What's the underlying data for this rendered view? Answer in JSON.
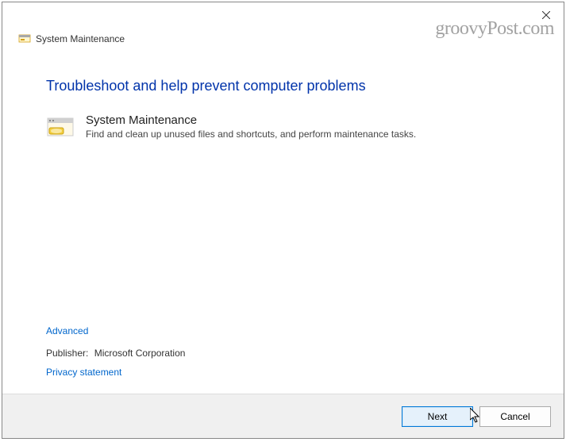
{
  "titlebar": {
    "title": "System Maintenance"
  },
  "watermark": "groovyPost.com",
  "main": {
    "heading": "Troubleshoot and help prevent computer problems",
    "item": {
      "title": "System Maintenance",
      "description": "Find and clean up unused files and shortcuts, and perform maintenance tasks."
    }
  },
  "links": {
    "advanced": "Advanced",
    "privacy": "Privacy statement"
  },
  "publisher": {
    "label": "Publisher:",
    "value": "Microsoft Corporation"
  },
  "footer": {
    "next": "Next",
    "cancel": "Cancel"
  }
}
